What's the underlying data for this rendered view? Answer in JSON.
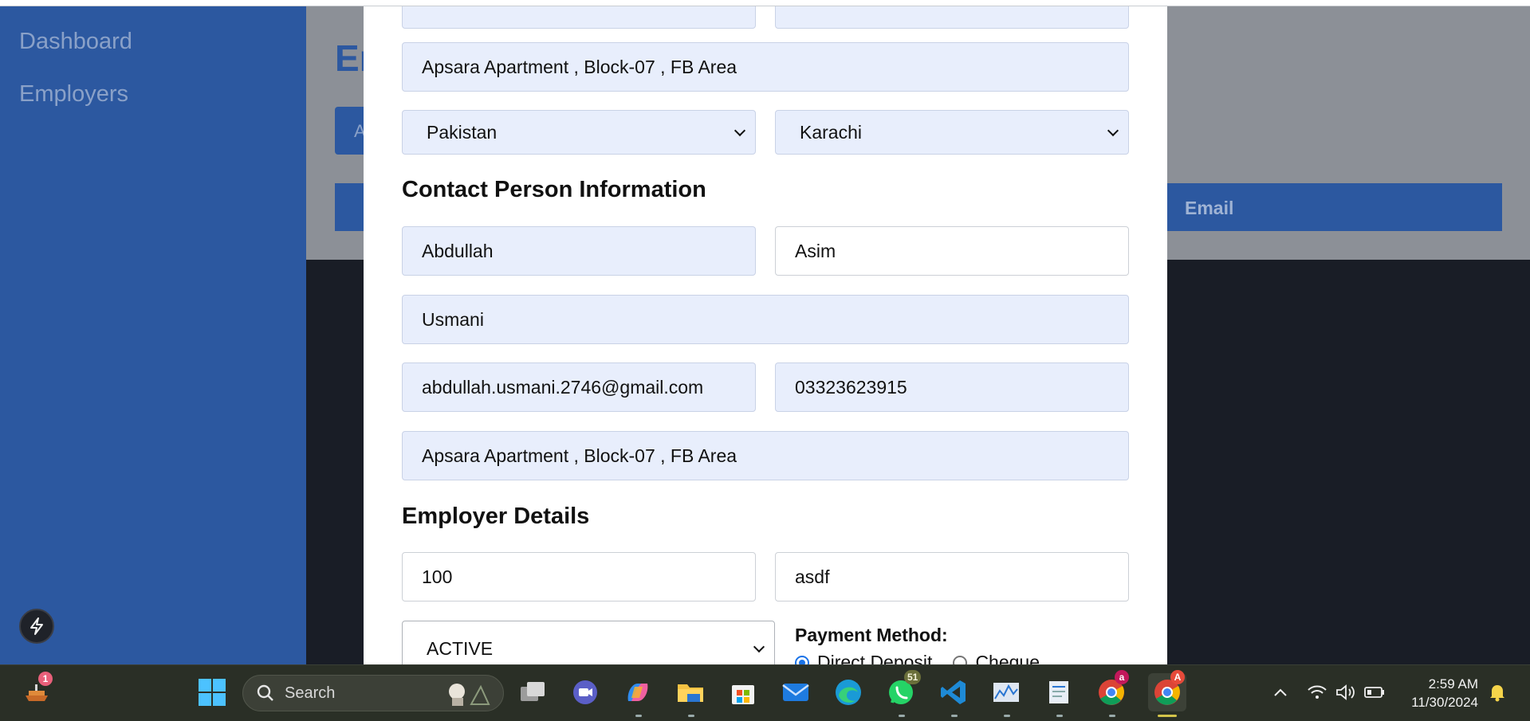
{
  "sidebar": {
    "items": [
      {
        "label": "Dashboard"
      },
      {
        "label": "Employers"
      }
    ]
  },
  "background": {
    "title_fragment": "Er",
    "add_button_fragment": "A",
    "table_header_email": "Email"
  },
  "modal": {
    "address_1": "Apsara Apartment , Block-07 , FB Area",
    "country_selected": "Pakistan",
    "city_selected": "Karachi",
    "contact_section_title": "Contact Person Information",
    "contact": {
      "first_name": "Abdullah",
      "middle_name": "Asim",
      "last_name": "Usmani",
      "email": "abdullah.usmani.2746@gmail.com",
      "phone": "03323623915",
      "address": "Apsara Apartment , Block-07 , FB Area"
    },
    "employer_section_title": "Employer Details",
    "employer": {
      "field_1": "100",
      "field_2": "asdf",
      "status_selected": "ACTIVE",
      "payment_method_label": "Payment Method:",
      "payment_options": [
        "Direct Deposit",
        "Cheque"
      ],
      "payment_selected": "Direct Deposit"
    }
  },
  "taskbar": {
    "search_placeholder": "Search",
    "notification_badge": "1",
    "whatsapp_badge": "51",
    "chrome_badge_1": "a",
    "chrome_badge_2": "A",
    "time": "2:59 AM",
    "date": "11/30/2024"
  },
  "colors": {
    "sidebar": "#2c58a0",
    "overlay": "#8c9097",
    "field_fill": "#e8eefc",
    "taskbar": "#2a2f26"
  }
}
